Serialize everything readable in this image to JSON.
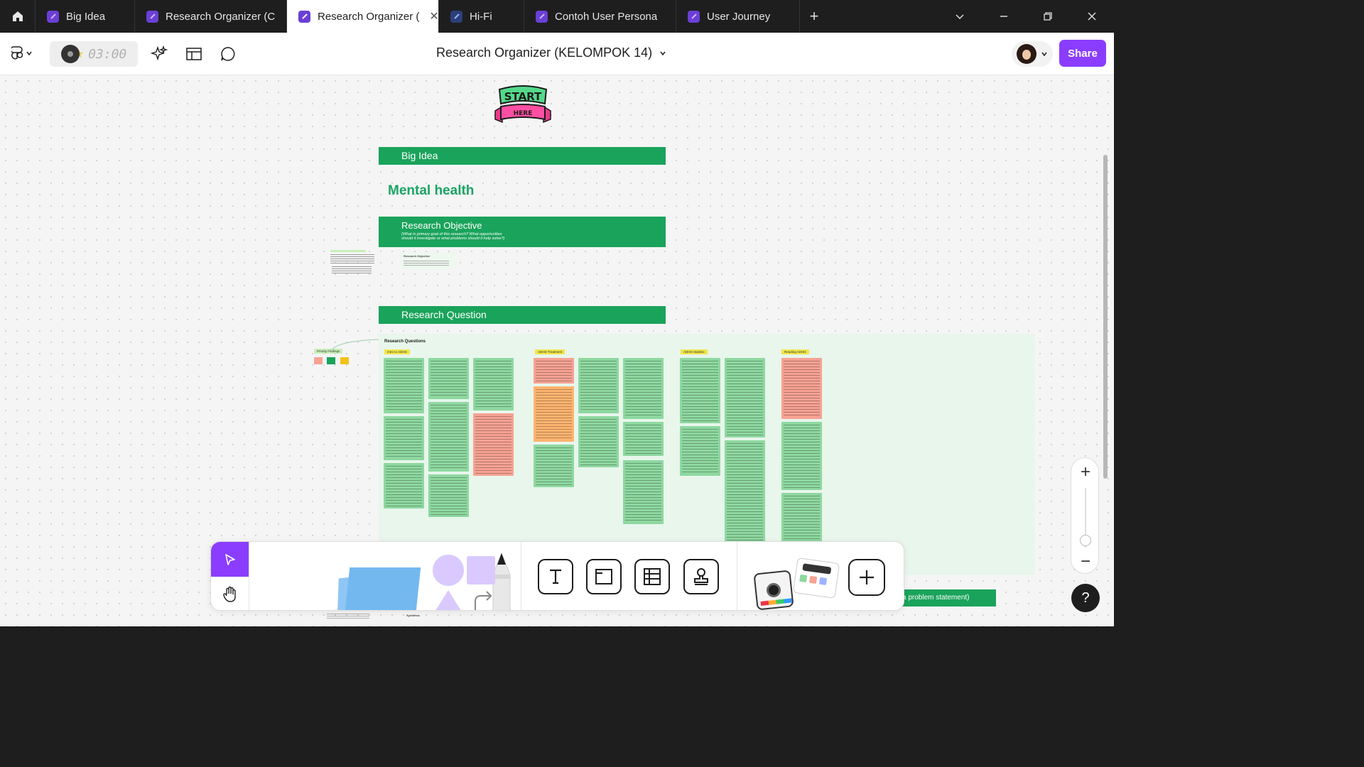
{
  "tabs": [
    {
      "label": "Big Idea",
      "active": false
    },
    {
      "label": "Research Organizer (C",
      "active": false
    },
    {
      "label": "Research Organizer (",
      "active": true
    },
    {
      "label": "Hi-Fi",
      "active": false
    },
    {
      "label": "Contoh User Persona",
      "active": false
    },
    {
      "label": "User Journey",
      "active": false
    }
  ],
  "toolbar": {
    "timer": "03:00",
    "doc_title": "Research Organizer (KELOMPOK 14)",
    "share_label": "Share"
  },
  "canvas": {
    "start_logo_top": "START",
    "start_logo_bottom": "HERE",
    "big_idea_label": "Big Idea",
    "big_idea_value": "Mental health",
    "research_objective_label": "Research Objective",
    "research_objective_hint_1": "(What is primary goal of this research? What opportunities",
    "research_objective_hint_2": "should it investigate or what problems should it help solve?)",
    "research_question_label": "Research Question",
    "research_questions_title": "Research Questions",
    "priority_findings_label": "Priority Findings",
    "research_objective_note": "Research Objective",
    "synthesis_label": "Synthesis",
    "categories": [
      "Intro to ADHD",
      "ADHD Treatment",
      "ADHD Statistic",
      "Reading ADHD"
    ],
    "bottom_banner": "a problem statement)"
  },
  "colors": {
    "accent": "#8b3dff",
    "banner_green": "#1aa35b",
    "text_green": "#19a463",
    "sticky_green": "#8ed8a0",
    "sticky_orange": "#ffb470",
    "sticky_red": "#f7a293",
    "board_bg": "#e8f6ec"
  },
  "icons": {
    "home": "home-icon",
    "figma_menu": "figma-menu-icon",
    "ai": "sparkle-icon",
    "layout": "layout-icon",
    "comment": "comment-icon",
    "plus": "plus-icon",
    "help": "help-icon"
  },
  "zoom": {
    "plus": "+",
    "minus": "−"
  },
  "help_label": "?"
}
